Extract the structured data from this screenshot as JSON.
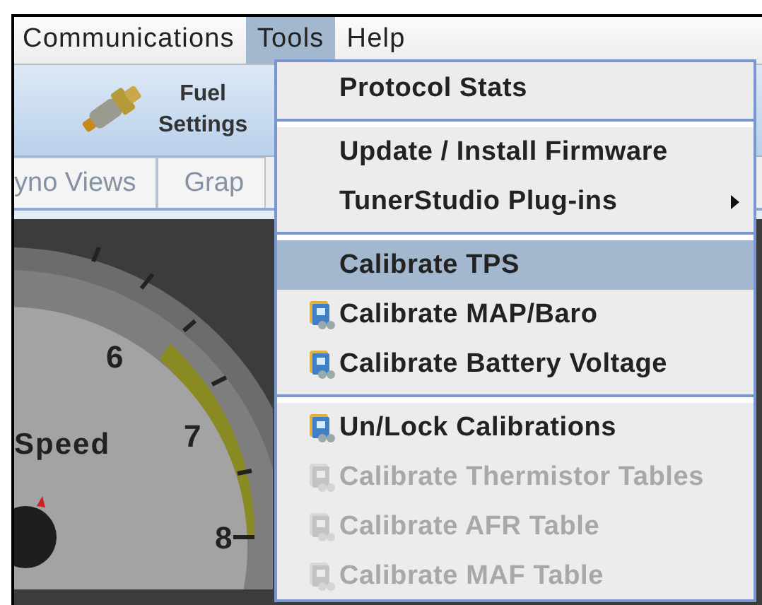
{
  "menu_bar": [
    {
      "label": "Communications",
      "selected": false
    },
    {
      "label": "Tools",
      "selected": true
    },
    {
      "label": "Help",
      "selected": false
    }
  ],
  "toolbar": [
    {
      "label_lines": [
        "Fuel",
        "Settings"
      ]
    }
  ],
  "tabs": [
    {
      "label": "yno Views"
    },
    {
      "label": "Grap"
    }
  ],
  "gauge": {
    "title": "Speed",
    "ticks": [
      "6",
      "7",
      "8"
    ]
  },
  "dropdown": {
    "items": [
      {
        "kind": "item",
        "label": "Protocol Stats",
        "icon": false,
        "disabled": false,
        "selected": false,
        "submenu": false
      },
      {
        "kind": "separator"
      },
      {
        "kind": "item",
        "label": "Update / Install Firmware",
        "icon": false,
        "disabled": false,
        "selected": false,
        "submenu": false
      },
      {
        "kind": "item",
        "label": "TunerStudio Plug-ins",
        "icon": false,
        "disabled": false,
        "selected": false,
        "submenu": true
      },
      {
        "kind": "separator"
      },
      {
        "kind": "item",
        "label": "Calibrate TPS",
        "icon": false,
        "disabled": false,
        "selected": true,
        "submenu": false
      },
      {
        "kind": "item",
        "label": "Calibrate MAP/Baro",
        "icon": true,
        "disabled": false,
        "selected": false,
        "submenu": false
      },
      {
        "kind": "item",
        "label": "Calibrate Battery Voltage",
        "icon": true,
        "disabled": false,
        "selected": false,
        "submenu": false
      },
      {
        "kind": "separator"
      },
      {
        "kind": "item",
        "label": "Un/Lock Calibrations",
        "icon": true,
        "disabled": false,
        "selected": false,
        "submenu": false
      },
      {
        "kind": "item",
        "label": "Calibrate Thermistor Tables",
        "icon": true,
        "disabled": true,
        "selected": false,
        "submenu": false
      },
      {
        "kind": "item",
        "label": "Calibrate AFR Table",
        "icon": true,
        "disabled": true,
        "selected": false,
        "submenu": false
      },
      {
        "kind": "item",
        "label": "Calibrate MAF Table",
        "icon": true,
        "disabled": true,
        "selected": false,
        "submenu": false
      }
    ]
  }
}
